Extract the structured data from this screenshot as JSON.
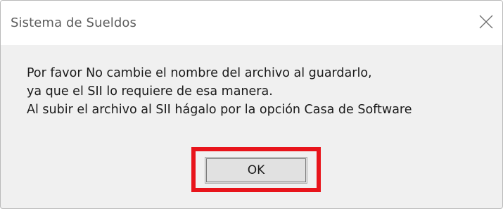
{
  "window": {
    "title": "Sistema de Sueldos",
    "close_icon": "close-icon"
  },
  "message": {
    "lines": [
      "Por favor No cambie el nombre del archivo al guardarlo,",
      "ya que el SII lo requiere de esa manera.",
      "Al subir el archivo al SII hágalo por la opción Casa de Software"
    ]
  },
  "buttons": {
    "ok_label": "OK"
  },
  "colors": {
    "highlight": "#e8141b",
    "dialog_bg": "#f0f0f0",
    "titlebar_bg": "#ffffff"
  }
}
